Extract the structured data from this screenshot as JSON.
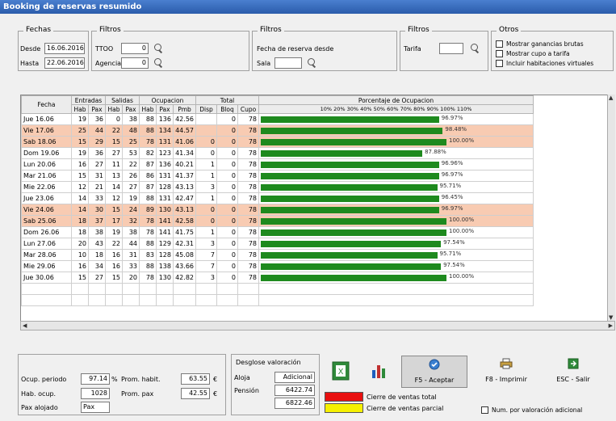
{
  "window": {
    "title": "Booking de reservas resumido"
  },
  "fechas": {
    "group_title": "Fechas",
    "desde_label": "Desde",
    "desde_value": "16.06.2016",
    "hasta_label": "Hasta",
    "hasta_value": "22.06.2016"
  },
  "filtros1": {
    "group_title": "Filtros",
    "ttoo_label": "TTOO",
    "ttoo_value": "0",
    "agencia_label": "Agencia",
    "agencia_value": "0"
  },
  "filtros2": {
    "group_title": "Filtros",
    "fecha_label": "Fecha de reserva desde",
    "sala_label": "Sala",
    "sala_value": ""
  },
  "filtros3": {
    "group_title": "Filtros",
    "tarifa_label": "Tarifa",
    "tarifa_value": ""
  },
  "otros": {
    "group_title": "Otros",
    "opt1": "Mostrar ganancias brutas",
    "opt2": "Mostrar cupo a tarifa",
    "opt3": "Incluir habitaciones virtuales"
  },
  "table": {
    "group_headers": [
      "Entradas",
      "Salidas",
      "Ocupacion",
      "Total",
      "Porcentaje de Ocupacion"
    ],
    "col_fecha": "Fecha",
    "sub_headers": [
      "Hab",
      "Pax",
      "Hab",
      "Pax",
      "Hab",
      "Pax",
      "Pmb",
      "Disp",
      "Bloq",
      "Cupo"
    ],
    "scale": "10%  20%  30%  40%  50%  60%  70%  80%  90%  100%  110%",
    "rows": [
      {
        "fecha": "Jue 16.06",
        "vals": [
          "19",
          "36",
          "0",
          "38",
          "88",
          "136",
          "42.56",
          "",
          "0",
          "78"
        ],
        "pct": 96,
        "pct_label": "96.97%",
        "hl": false
      },
      {
        "fecha": "Vie 17.06",
        "vals": [
          "25",
          "44",
          "22",
          "48",
          "88",
          "134",
          "44.57",
          "",
          "0",
          "78"
        ],
        "pct": 98,
        "pct_label": "98.48%",
        "hl": true
      },
      {
        "fecha": "Sab 18.06",
        "vals": [
          "15",
          "29",
          "15",
          "25",
          "78",
          "131",
          "41.06",
          "0",
          "0",
          "78"
        ],
        "pct": 100,
        "pct_label": "100.00%",
        "hl": true
      },
      {
        "fecha": "Dom 19.06",
        "vals": [
          "19",
          "36",
          "27",
          "53",
          "82",
          "123",
          "41.34",
          "0",
          "0",
          "78"
        ],
        "pct": 87,
        "pct_label": "87.88%",
        "hl": false
      },
      {
        "fecha": "Lun 20.06",
        "vals": [
          "16",
          "27",
          "11",
          "22",
          "87",
          "136",
          "40.21",
          "1",
          "0",
          "78"
        ],
        "pct": 96,
        "pct_label": "96.96%",
        "hl": false
      },
      {
        "fecha": "Mar 21.06",
        "vals": [
          "15",
          "31",
          "13",
          "26",
          "86",
          "131",
          "41.37",
          "1",
          "0",
          "78"
        ],
        "pct": 96,
        "pct_label": "96.97%",
        "hl": false
      },
      {
        "fecha": "Mie 22.06",
        "vals": [
          "12",
          "21",
          "14",
          "27",
          "87",
          "128",
          "43.13",
          "3",
          "0",
          "78"
        ],
        "pct": 95,
        "pct_label": "95.71%",
        "hl": false
      },
      {
        "fecha": "Jue 23.06",
        "vals": [
          "14",
          "33",
          "12",
          "19",
          "88",
          "131",
          "42.47",
          "1",
          "0",
          "78"
        ],
        "pct": 96,
        "pct_label": "96.45%",
        "hl": false
      },
      {
        "fecha": "Vie 24.06",
        "vals": [
          "14",
          "30",
          "15",
          "24",
          "89",
          "130",
          "43.13",
          "0",
          "0",
          "78"
        ],
        "pct": 96,
        "pct_label": "96.97%",
        "hl": true
      },
      {
        "fecha": "Sab 25.06",
        "vals": [
          "18",
          "37",
          "17",
          "32",
          "78",
          "141",
          "42.58",
          "0",
          "0",
          "78"
        ],
        "pct": 100,
        "pct_label": "100.00%",
        "hl": true
      },
      {
        "fecha": "Dom 26.06",
        "vals": [
          "18",
          "38",
          "19",
          "38",
          "78",
          "141",
          "41.75",
          "1",
          "0",
          "78"
        ],
        "pct": 100,
        "pct_label": "100.00%",
        "hl": false
      },
      {
        "fecha": "Lun 27.06",
        "vals": [
          "20",
          "43",
          "22",
          "44",
          "88",
          "129",
          "42.31",
          "3",
          "0",
          "78"
        ],
        "pct": 97,
        "pct_label": "97.54%",
        "hl": false
      },
      {
        "fecha": "Mar 28.06",
        "vals": [
          "10",
          "18",
          "16",
          "31",
          "83",
          "128",
          "45.08",
          "7",
          "0",
          "78"
        ],
        "pct": 95,
        "pct_label": "95.71%",
        "hl": false
      },
      {
        "fecha": "Mie 29.06",
        "vals": [
          "16",
          "34",
          "16",
          "33",
          "88",
          "138",
          "43.66",
          "7",
          "0",
          "78"
        ],
        "pct": 97,
        "pct_label": "97.54%",
        "hl": false
      },
      {
        "fecha": "Jue 30.06",
        "vals": [
          "15",
          "27",
          "15",
          "20",
          "78",
          "130",
          "42.82",
          "3",
          "0",
          "78"
        ],
        "pct": 100,
        "pct_label": "100.00%",
        "hl": false
      }
    ]
  },
  "summary": {
    "ocup_label": "Ocup. periodo",
    "ocup_value": "97.14",
    "ocup_unit": "%",
    "prom_habit_label": "Prom. habit.",
    "prom_habit_value": "63.55",
    "prom_habit_unit": "€",
    "hab_label": "Hab. ocup.",
    "hab_value": "1028",
    "prom_pax_label": "Prom. pax",
    "prom_pax_value": "42.55",
    "prom_pax_unit": "€",
    "pax_label": "Pax alojado",
    "pax_value": "Pax"
  },
  "desglose": {
    "title": "Desglose valoración",
    "row1_label": "Aloja",
    "row1_value": "Adicional",
    "row2_label": "Pensión",
    "row2_value": "6422.74",
    "row3_value": "6822.46"
  },
  "buttons": {
    "excel": "",
    "chart": "",
    "aceptar": "F5 - Aceptar",
    "imprimir": "F8 - Imprimir",
    "salir": "ESC - Salir"
  },
  "legend": {
    "red_label": "Cierre de ventas total",
    "yellow_label": "Cierre de ventas parcial",
    "check_label": "Num. por valoración adicional",
    "red_color": "#e81010",
    "yellow_color": "#f6f000"
  }
}
